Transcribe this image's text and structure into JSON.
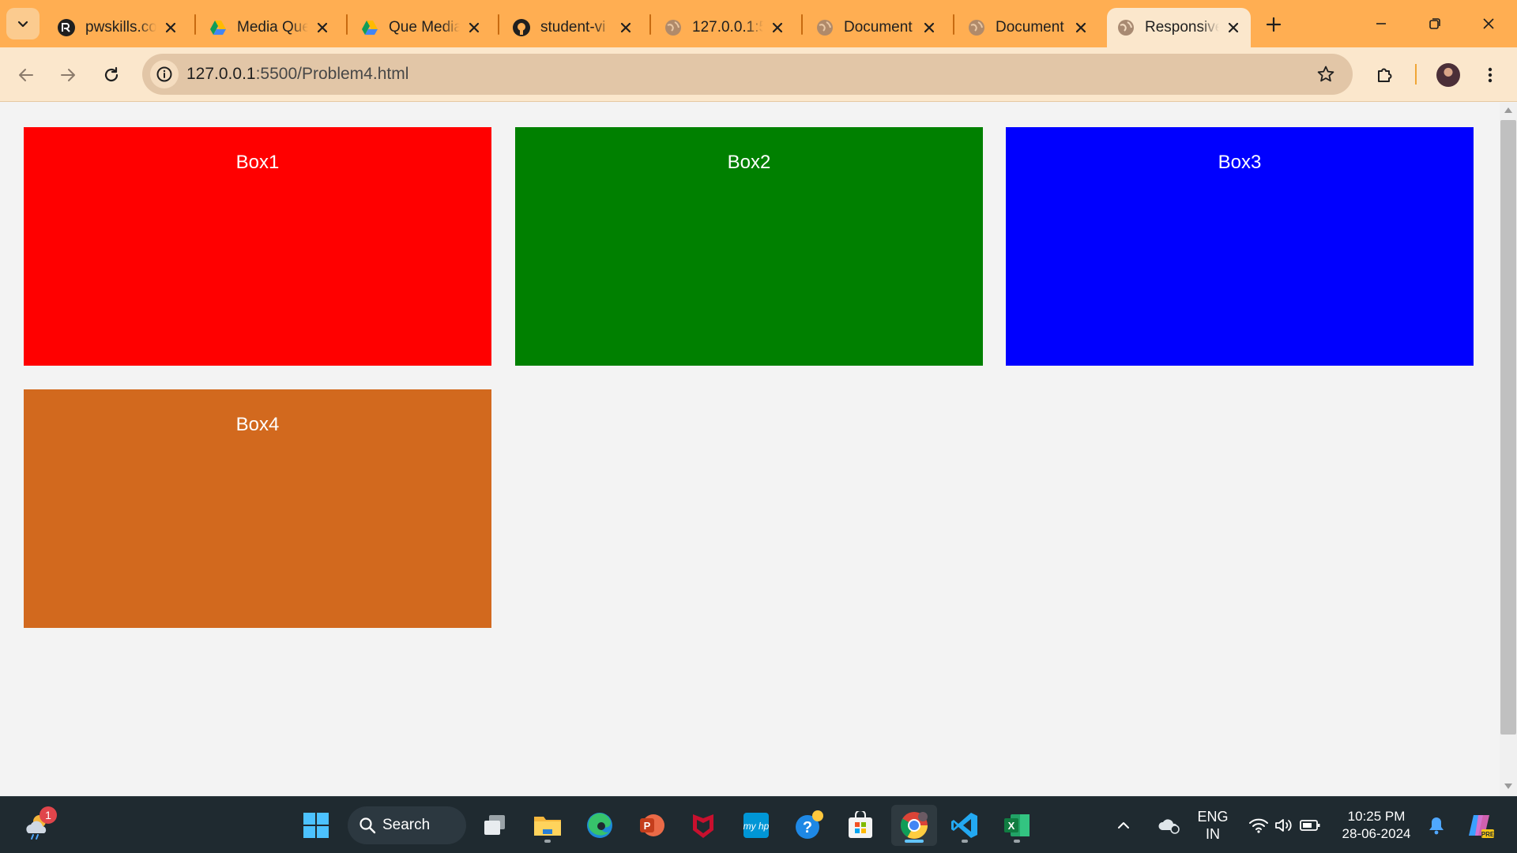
{
  "browser": {
    "tabs": [
      {
        "title": "pwskills.co",
        "favicon": "pwskills-icon"
      },
      {
        "title": "Media Que",
        "favicon": "google-drive-icon"
      },
      {
        "title": "Que Media",
        "favicon": "google-drive-icon"
      },
      {
        "title": "student-vi",
        "favicon": "github-icon"
      },
      {
        "title": "127.0.0.1:5",
        "favicon": "globe-icon"
      },
      {
        "title": "Document",
        "favicon": "globe-icon"
      },
      {
        "title": "Document",
        "favicon": "globe-icon"
      },
      {
        "title": "Responsive",
        "favicon": "globe-icon",
        "active": true
      }
    ],
    "address": {
      "host": "127.0.0.1",
      "path": ":5500/Problem4.html"
    },
    "theme": {
      "frame": "#ffae52",
      "toolbar": "#fbe7cc",
      "omnibox": "#e2c6a7"
    }
  },
  "page": {
    "boxes": [
      {
        "label": "Box1",
        "color": "#ff0000"
      },
      {
        "label": "Box2",
        "color": "#008000"
      },
      {
        "label": "Box3",
        "color": "#0000ff"
      },
      {
        "label": "Box4",
        "color": "#d2691e"
      }
    ]
  },
  "taskbar": {
    "weather_badge": "1",
    "search_label": "Search",
    "language": {
      "line1": "ENG",
      "line2": "IN"
    },
    "clock": {
      "time": "10:25 PM",
      "date": "28-06-2024"
    },
    "apps": [
      "windows-start-icon",
      "task-view-icon",
      "file-explorer-icon",
      "edge-icon",
      "powerpoint-icon",
      "mcafee-icon",
      "myhp-icon",
      "get-help-icon",
      "microsoft-store-icon",
      "chrome-icon",
      "vscode-icon",
      "excel-icon"
    ]
  }
}
